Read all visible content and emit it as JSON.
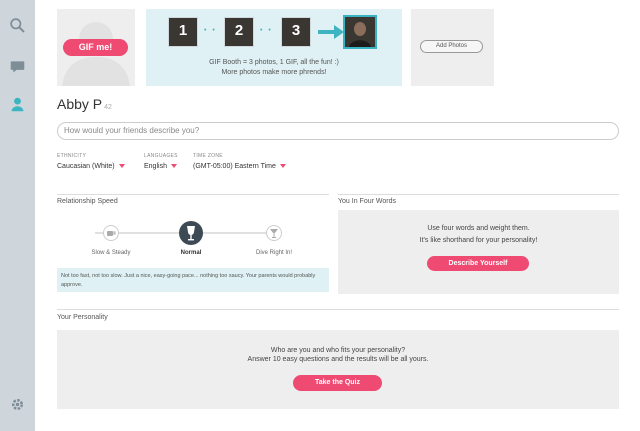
{
  "sidebar": {
    "icons": [
      "search-icon",
      "chat-icon",
      "profile-icon",
      "gear-icon"
    ],
    "accent": "#3db4c1"
  },
  "photo": {
    "gif_button": "GIF me!"
  },
  "gif_booth": {
    "numbers": [
      "1",
      "2",
      "3"
    ],
    "line1": "GIF Booth = 3 photos, 1 GIF, all the fun! :)",
    "line2": "More photos make more phrends!"
  },
  "add_photos": {
    "label": "Add Photos"
  },
  "profile": {
    "name": "Abby P",
    "age": "42"
  },
  "describe": {
    "placeholder": "How would your friends describe you?"
  },
  "fields": {
    "ethnicity": {
      "label": "ETHNICITY",
      "value": "Caucasian (White)"
    },
    "languages": {
      "label": "LANGUAGES",
      "value": "English"
    },
    "timezone": {
      "label": "TIME ZONE",
      "value": "(GMT-05:00) Eastern Time"
    }
  },
  "relationship_speed": {
    "title": "Relationship Speed",
    "stops": [
      "Slow & Steady",
      "Normal",
      "Dive Right In!"
    ],
    "selected": "Normal",
    "description": "Not too fast, not too slow. Just a nice, easy-going pace... nothing too saucy. Your parents would probably approve."
  },
  "four_words": {
    "title": "You In Four Words",
    "line1": "Use four words and weight them.",
    "line2": "It's like shorthand for your personality!",
    "button": "Describe Yourself"
  },
  "personality": {
    "title": "Your Personality",
    "line1": "Who are you and who fits your personality?",
    "line2": "Answer 10 easy questions and the results will be all yours.",
    "button": "Take the Quiz"
  },
  "colors": {
    "pink": "#ee4a72",
    "teal": "#3db4c1",
    "sidebar": "#ced6dc"
  }
}
